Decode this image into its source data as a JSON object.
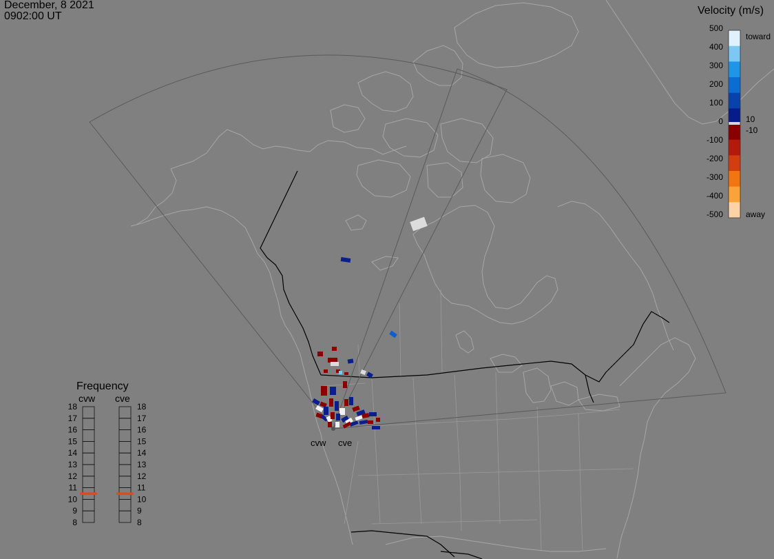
{
  "header": {
    "date": "December, 8 2021",
    "time": "0902:00 UT"
  },
  "velocity_legend": {
    "title": "Velocity (m/s)",
    "ticks": [
      "500",
      "400",
      "300",
      "200",
      "100",
      "0",
      "-100",
      "-200",
      "-300",
      "-400",
      "-500"
    ],
    "label_toward": "toward",
    "label_away": "away",
    "label_pos_threshold": "10",
    "label_neg_threshold": "-10",
    "colors": [
      "#dff1fb",
      "#7cc8f3",
      "#1f95e8",
      "#0b6cd1",
      "#0842ac",
      "#071c8a",
      "#8a0000",
      "#b31a0b",
      "#d43d10",
      "#f27512",
      "#f9a33a",
      "#fdd3a6"
    ]
  },
  "frequency_panel": {
    "title": "Frequency",
    "radars": [
      "cvw",
      "cve"
    ],
    "scale": [
      "18",
      "17",
      "16",
      "15",
      "14",
      "13",
      "12",
      "11",
      "10",
      "9",
      "8"
    ],
    "cvw_frequency_mhz": 10.5,
    "cve_frequency_mhz": 10.5,
    "marker_color": "#e84818"
  },
  "radar_sites": {
    "west_label": "cvw",
    "east_label": "cve"
  },
  "colors": {
    "background": "#808080",
    "coastline": "#a8a8a8",
    "fov": "#5a5a5a",
    "border": "#000000"
  }
}
